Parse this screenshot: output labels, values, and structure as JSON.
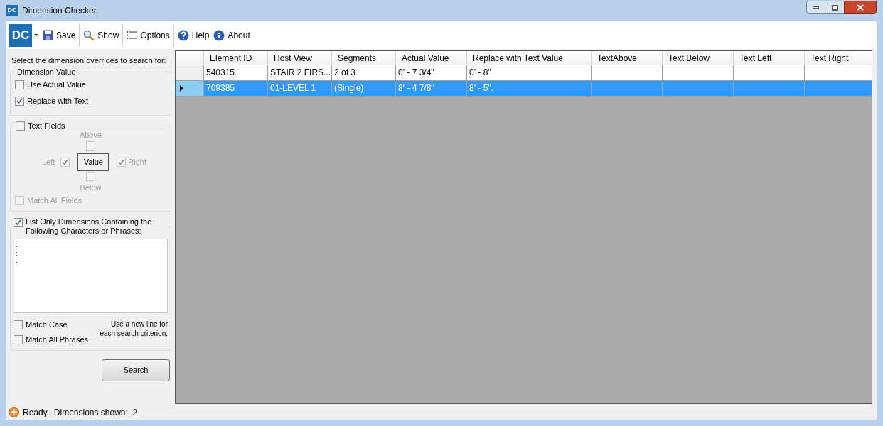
{
  "window": {
    "title": "Dimension Checker",
    "logo": "DC"
  },
  "toolbar": {
    "logo": "DC",
    "buttons": [
      {
        "label": "Save",
        "kind": "save"
      },
      {
        "label": "Show",
        "kind": "show"
      },
      {
        "label": "Options",
        "kind": "options"
      },
      {
        "label": "Help",
        "kind": "help"
      },
      {
        "label": "About",
        "kind": "about"
      }
    ]
  },
  "panel": {
    "intro": "Select the dimension overrides to search for:",
    "dimension_value": {
      "title": "Dimension Value",
      "options": [
        {
          "label": "Use Actual Value",
          "checked": false
        },
        {
          "label": "Replace with Text",
          "checked": true
        }
      ]
    },
    "text_fields": {
      "label": "Text Fields",
      "checked": false,
      "disabled": true,
      "above": {
        "label": "Above",
        "checked": false
      },
      "left": {
        "label": "Left",
        "checked": true
      },
      "value_button": "Value",
      "right": {
        "label": "Right",
        "checked": true
      },
      "below": {
        "label": "Below",
        "checked": false
      },
      "match_all": {
        "label": "Match All Fields",
        "checked": false
      }
    },
    "phrases": {
      "label": "List Only Dimensions Containing the Following Characters or Phrases:",
      "checked": true,
      "value": ".\n:\n-",
      "match_case": {
        "label": "Match Case",
        "checked": false
      },
      "match_all": {
        "label": "Match All Phrases",
        "checked": false
      },
      "hint": "Use a new line for each search criterion."
    },
    "search_button": "Search"
  },
  "table": {
    "columns": [
      "Element ID",
      "Host View",
      "Segments",
      "Actual Value",
      "Replace with Text Value",
      "TextAbove",
      "Text Below",
      "Text Left",
      "Text Right"
    ],
    "rows": [
      {
        "selected": false,
        "current": false,
        "cells": [
          "540315",
          "STAIR 2 FIRS...",
          "2 of 3",
          "0' - 7 3/4\"",
          "0' - 8\"",
          "",
          "",
          "",
          ""
        ]
      },
      {
        "selected": true,
        "current": true,
        "cells": [
          "709385",
          "01-LEVEL 1",
          "(Single)",
          "8' - 4 7/8\"",
          "8' - 5\".",
          "",
          "",
          "",
          ""
        ]
      }
    ]
  },
  "status_bar": {
    "text": "Ready.  Dimensions shown:  2"
  }
}
